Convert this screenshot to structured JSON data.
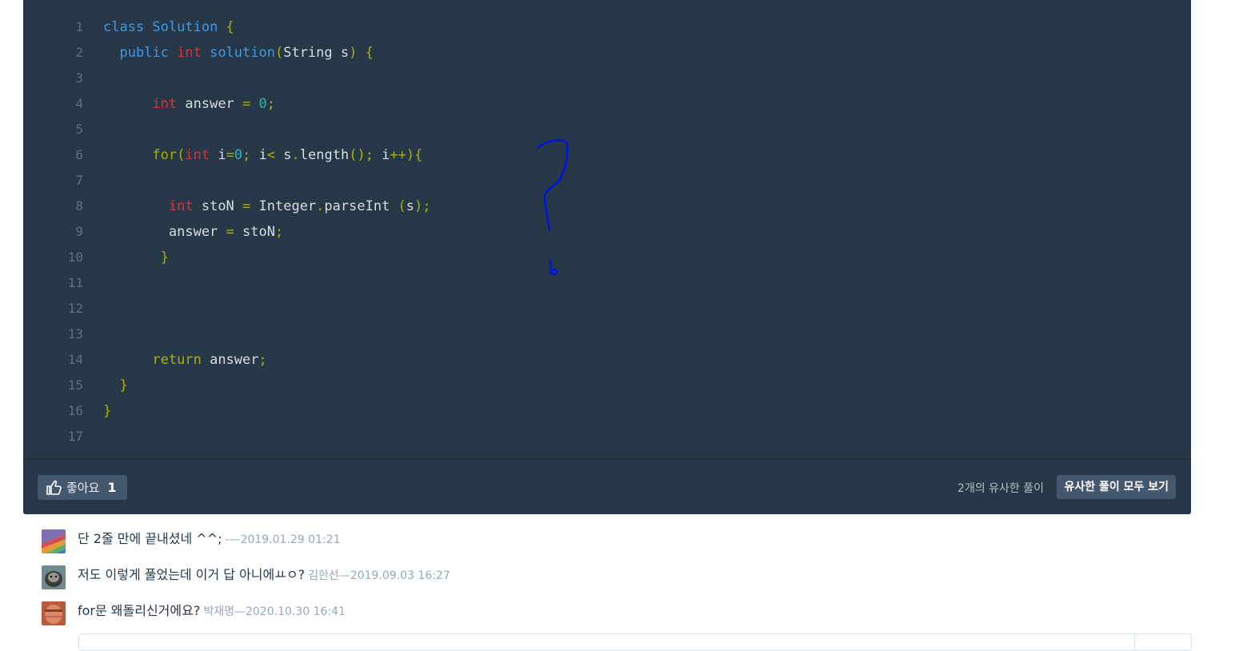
{
  "code": {
    "lines": [
      {
        "n": "1",
        "tokens": [
          {
            "t": "class ",
            "c": "kw"
          },
          {
            "t": "Solution",
            "c": "fn"
          },
          {
            "t": " {",
            "c": "p"
          }
        ]
      },
      {
        "n": "2",
        "tokens": [
          {
            "t": "  public ",
            "c": "kw"
          },
          {
            "t": "int ",
            "c": "type"
          },
          {
            "t": "solution",
            "c": "fn"
          },
          {
            "t": "(",
            "c": "p"
          },
          {
            "t": "String s",
            "c": "id"
          },
          {
            "t": ") {",
            "c": "p"
          }
        ]
      },
      {
        "n": "3",
        "tokens": []
      },
      {
        "n": "4",
        "tokens": [
          {
            "t": "      ",
            "c": "id"
          },
          {
            "t": "int ",
            "c": "type"
          },
          {
            "t": "answer ",
            "c": "id"
          },
          {
            "t": "= ",
            "c": "op"
          },
          {
            "t": "0",
            "c": "num"
          },
          {
            "t": ";",
            "c": "p"
          }
        ]
      },
      {
        "n": "5",
        "tokens": []
      },
      {
        "n": "6",
        "tokens": [
          {
            "t": "      ",
            "c": "id"
          },
          {
            "t": "for(",
            "c": "ctl"
          },
          {
            "t": "int ",
            "c": "type"
          },
          {
            "t": "i",
            "c": "id"
          },
          {
            "t": "=",
            "c": "op"
          },
          {
            "t": "0",
            "c": "num"
          },
          {
            "t": "; ",
            "c": "p"
          },
          {
            "t": "i",
            "c": "id"
          },
          {
            "t": "< ",
            "c": "op"
          },
          {
            "t": "s",
            "c": "id"
          },
          {
            "t": ".",
            "c": "p"
          },
          {
            "t": "length",
            "c": "id"
          },
          {
            "t": "(); ",
            "c": "p"
          },
          {
            "t": "i",
            "c": "id"
          },
          {
            "t": "++){",
            "c": "p"
          }
        ]
      },
      {
        "n": "7",
        "tokens": []
      },
      {
        "n": "8",
        "tokens": [
          {
            "t": "        ",
            "c": "id"
          },
          {
            "t": "int ",
            "c": "type"
          },
          {
            "t": "stoN ",
            "c": "id"
          },
          {
            "t": "= ",
            "c": "op"
          },
          {
            "t": "Integer",
            "c": "id"
          },
          {
            "t": ".",
            "c": "p"
          },
          {
            "t": "parseInt ",
            "c": "id"
          },
          {
            "t": "(",
            "c": "p"
          },
          {
            "t": "s",
            "c": "id"
          },
          {
            "t": ");",
            "c": "p"
          }
        ]
      },
      {
        "n": "9",
        "tokens": [
          {
            "t": "        answer ",
            "c": "id"
          },
          {
            "t": "= ",
            "c": "op"
          },
          {
            "t": "stoN",
            "c": "id"
          },
          {
            "t": ";",
            "c": "p"
          }
        ]
      },
      {
        "n": "10",
        "tokens": [
          {
            "t": "       }",
            "c": "p"
          }
        ]
      },
      {
        "n": "11",
        "tokens": []
      },
      {
        "n": "12",
        "tokens": []
      },
      {
        "n": "13",
        "tokens": []
      },
      {
        "n": "14",
        "tokens": [
          {
            "t": "      ",
            "c": "id"
          },
          {
            "t": "return ",
            "c": "ctl"
          },
          {
            "t": "answer",
            "c": "id"
          },
          {
            "t": ";",
            "c": "p"
          }
        ]
      },
      {
        "n": "15",
        "tokens": [
          {
            "t": "  }",
            "c": "p"
          }
        ]
      },
      {
        "n": "16",
        "tokens": [
          {
            "t": "}",
            "c": "p"
          }
        ]
      },
      {
        "n": "17",
        "tokens": []
      }
    ]
  },
  "footer": {
    "like_label": "좋아요",
    "like_count": "1",
    "similar_count_text": "2개의 유사한 풀이",
    "similar_button": "유사한 풀이 모두 보기"
  },
  "comments": [
    {
      "text": "단 2줄 만에 끝내셨네 ^^;",
      "meta": "-—2019.01.29 01:21",
      "avatar": "colorful-stripes"
    },
    {
      "text": "저도 이렇게 풀었는데 이거 답 아니에ㅛㅇ?",
      "meta": "김한선—2019.09.03 16:27",
      "avatar": "animal-photo"
    },
    {
      "text": "for문 왜돌리신거에요?",
      "meta": "박재명—2020.10.30 16:41",
      "avatar": "face-photo"
    }
  ],
  "colors": {
    "panel_bg": "#263747",
    "keyword": "#3d9be9",
    "type": "#e0322f",
    "number": "#2ab7a9",
    "punct": "#a6b400",
    "scribble": "#0014e0"
  }
}
